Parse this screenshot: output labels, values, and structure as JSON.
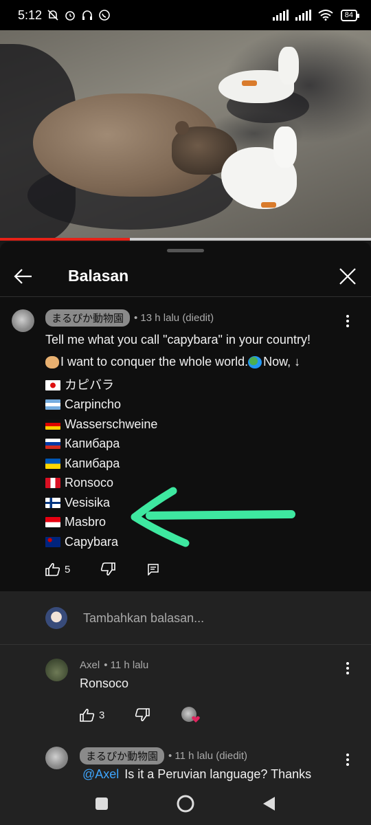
{
  "status_bar": {
    "time": "5:12",
    "battery": "84"
  },
  "video": {
    "progress": 0.35
  },
  "panel": {
    "title": "Balasan"
  },
  "main_comment": {
    "author": "まるぴか動物園",
    "meta": "• 13 h lalu (diedit)",
    "line1": "Tell me what you call \"capybara\" in your country!",
    "line2_start": "I want to conquer the whole world.",
    "line2_end": "Now, ↓",
    "entries": [
      {
        "flag": "japan",
        "name": "カピバラ"
      },
      {
        "flag": "argentina",
        "name": "Carpincho"
      },
      {
        "flag": "germany",
        "name": "Wasserschweine"
      },
      {
        "flag": "russia",
        "name": "Капибара"
      },
      {
        "flag": "ukraine",
        "name": "Капибара"
      },
      {
        "flag": "peru",
        "name": "Ronsoco"
      },
      {
        "flag": "finland",
        "name": "Vesisika"
      },
      {
        "flag": "indonesia",
        "name": "Masbro"
      },
      {
        "flag": "australia",
        "name": "Capybara"
      }
    ],
    "likes": "5"
  },
  "add_reply": {
    "placeholder": "Tambahkan balasan..."
  },
  "replies": [
    {
      "author": "Axel",
      "meta": "• 11 h lalu",
      "text": "Ronsoco",
      "likes": "3"
    },
    {
      "author": "まるぴか動物園",
      "meta": "• 11 h lalu (diedit)",
      "mention": "@Axel",
      "text": "Is it a Peruvian language? Thanks"
    }
  ],
  "colors": {
    "accent_link": "#3ea6ff",
    "progress": "#e62117",
    "annotation_arrow": "#3ee8a0",
    "heart": "#e0245e"
  }
}
